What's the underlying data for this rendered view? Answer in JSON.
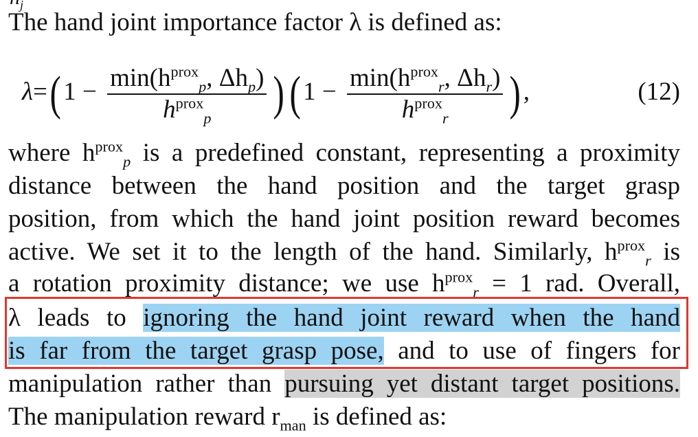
{
  "top_fragment": "h",
  "top_fragment_sub": "j",
  "intro": "The hand joint importance factor λ is defined as:",
  "equation": {
    "lhs": "λ",
    "one": "1",
    "minus": "−",
    "min_p": "min(h",
    "sym_p": "p",
    "sym_r": "r",
    "prox": "prox",
    "delta_p": ", Δh",
    "close": ")",
    "h": "h",
    "comma": ",",
    "number": "(12)"
  },
  "lines": {
    "l1_a": "where h",
    "l1_b": " is a predefined constant, representing a proximity",
    "l2": "distance between the hand position and the target grasp",
    "l3": "position, from which the hand joint position reward becomes",
    "l4_a": "active. We set it to the length of the hand. Similarly, h",
    "l4_b": " is",
    "l5_a": "a rotation proximity distance; we use h",
    "l5_b": " = 1 rad. Overall,",
    "l6_a": "λ leads to ",
    "l6_hl": "ignoring the hand joint reward when the hand",
    "l7_hl": "is far from the target grasp pose,",
    "l7_b": " and to use of fingers for",
    "l8_a": "manipulation rather than ",
    "l8_hl": "pursuing yet distant target positions.",
    "l9_a": "The manipulation reward r",
    "l9_sub": "man",
    "l9_b": " is defined as:"
  }
}
